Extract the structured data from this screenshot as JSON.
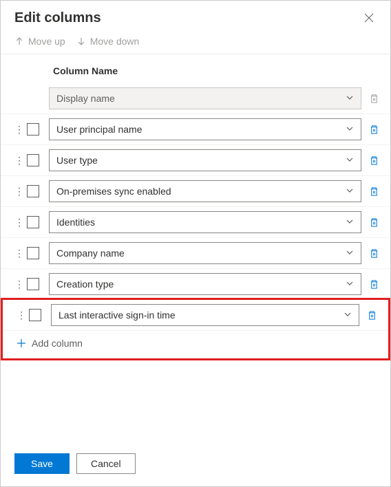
{
  "header": {
    "title": "Edit columns"
  },
  "toolbar": {
    "move_up": "Move up",
    "move_down": "Move down"
  },
  "list": {
    "header": "Column Name",
    "locked_column": "Display name",
    "columns": [
      "User principal name",
      "User type",
      "On-premises sync enabled",
      "Identities",
      "Company name",
      "Creation type",
      "Last interactive sign-in time"
    ],
    "add_label": "Add column"
  },
  "footer": {
    "save": "Save",
    "cancel": "Cancel"
  }
}
